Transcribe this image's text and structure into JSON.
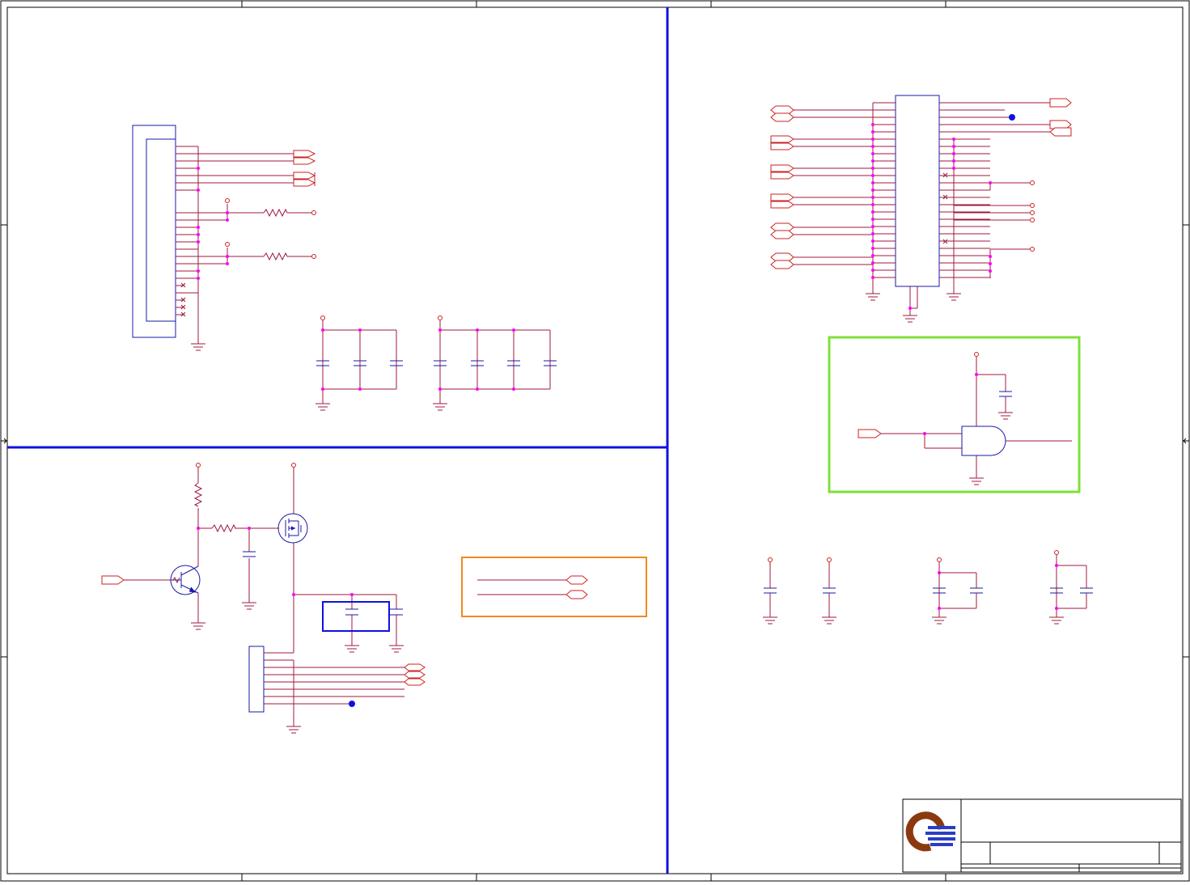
{
  "sheet": {
    "title": "",
    "colors": {
      "wire": "#a0183c",
      "part": "#1a1aa8",
      "divider": "#1010e0",
      "connector": "#cc2222",
      "border": "#000000",
      "junction": "#ff00ff",
      "highlight_green": "#7ee03a",
      "highlight_orange": "#f08a1e",
      "logo_brown": "#8b3a10",
      "logo_blue": "#2b3cc8"
    }
  },
  "title_block": {
    "logo_icon": "company-logo-icon",
    "title_text": "",
    "rev_text": ""
  },
  "icons": {
    "resistor": "resistor-icon",
    "capacitor": "capacitor-icon",
    "ground": "ground-icon",
    "power": "power-pin-icon",
    "transistor_npn": "npn-transistor-icon",
    "mosfet": "mosfet-icon",
    "and_gate": "and-gate-icon",
    "connector_port": "port-arrow-icon"
  }
}
